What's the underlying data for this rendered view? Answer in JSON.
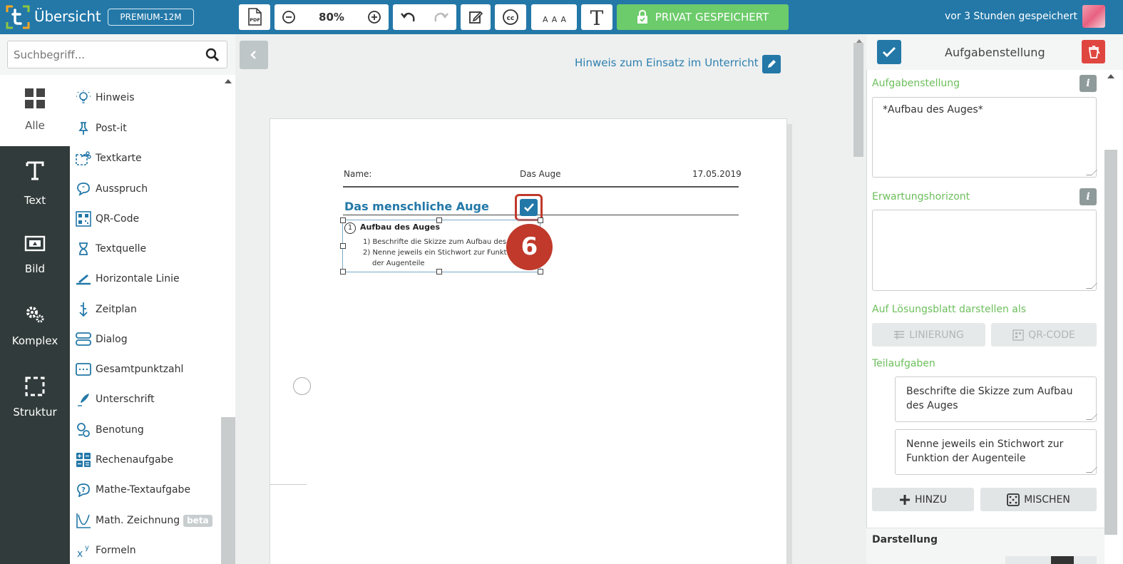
{
  "topbar": {
    "title": "Übersicht",
    "plan_badge": "PREMIUM-12M",
    "zoom": "80%",
    "privat_label": "PRIVAT GESPEICHERT",
    "save_status": "vor 3 Stunden gespeichert",
    "pdf_label": "PDF",
    "font_size_label": "AAA",
    "font_label": "T",
    "colors": {
      "bar": "#2378a8",
      "privat": "#6ccb6a"
    }
  },
  "rail": {
    "items": [
      {
        "label": "Alle",
        "icon": "grid-icon"
      },
      {
        "label": "Text",
        "icon": "text-t-icon"
      },
      {
        "label": "Bild",
        "icon": "image-icon"
      },
      {
        "label": "Komplex",
        "icon": "gears-icon"
      },
      {
        "label": "Struktur",
        "icon": "dashed-square-icon"
      }
    ]
  },
  "search": {
    "placeholder": "Suchbegriff..."
  },
  "elements": [
    {
      "label": "Hinweis",
      "icon": "lightbulb-icon"
    },
    {
      "label": "Post-it",
      "icon": "pin-icon"
    },
    {
      "label": "Textkarte",
      "icon": "scissors-card-icon"
    },
    {
      "label": "Ausspruch",
      "icon": "speech-bubble-icon"
    },
    {
      "label": "QR-Code",
      "icon": "qr-code-icon"
    },
    {
      "label": "Textquelle",
      "icon": "hourglass-icon"
    },
    {
      "label": "Horizontale Linie",
      "icon": "horizontal-line-icon"
    },
    {
      "label": "Zeitplan",
      "icon": "timeline-icon"
    },
    {
      "label": "Dialog",
      "icon": "dialog-icon"
    },
    {
      "label": "Gesamtpunktzahl",
      "icon": "score-icon"
    },
    {
      "label": "Unterschrift",
      "icon": "pen-icon"
    },
    {
      "label": "Benotung",
      "icon": "grading-icon"
    },
    {
      "label": "Rechenaufgabe",
      "icon": "calculator-icon"
    },
    {
      "label": "Mathe-Textaufgabe",
      "icon": "question-bubble-icon"
    },
    {
      "label": "Math. Zeichnung",
      "icon": "curve-icon",
      "badge": "beta"
    },
    {
      "label": "Formeln",
      "icon": "formula-icon",
      "glyph": "x",
      "sup": "y"
    }
  ],
  "canvas": {
    "hint_link": "Hinweis zum Einsatz im Unterricht",
    "header": {
      "name_label": "Name:",
      "topic": "Das Auge",
      "date": "17.05.2019"
    },
    "title": "Das menschliche Auge",
    "task": {
      "number": "1",
      "title": "Aufbau des Auges",
      "lines": [
        "1) Beschrifte die Skizze zum Aufbau des",
        "2) Nenne jeweils ein Stichwort zur Funkt",
        "der Augenteile"
      ]
    },
    "badge": "6"
  },
  "props": {
    "title": "Aufgabenstellung",
    "aufgabenstellung_label": "Aufgabenstellung",
    "aufgabenstellung_value": "*Aufbau des Auges*",
    "erwartung_label": "Erwartungshorizont",
    "erwartung_value": "",
    "info_glyph": "i",
    "loesung_label": "Auf Lösungsblatt darstellen als",
    "linierung_label": "LINIERUNG",
    "qr_label": "QR-CODE",
    "teilaufgaben_label": "Teilaufgaben",
    "teilaufgaben": [
      "Beschrifte die Skizze zum Aufbau des Auges",
      "Nenne jeweils ein Stichwort zur Funktion der Augenteile"
    ],
    "hinzu_label": "HINZU",
    "mischen_label": "MISCHEN",
    "darstellung_label": "Darstellung"
  }
}
